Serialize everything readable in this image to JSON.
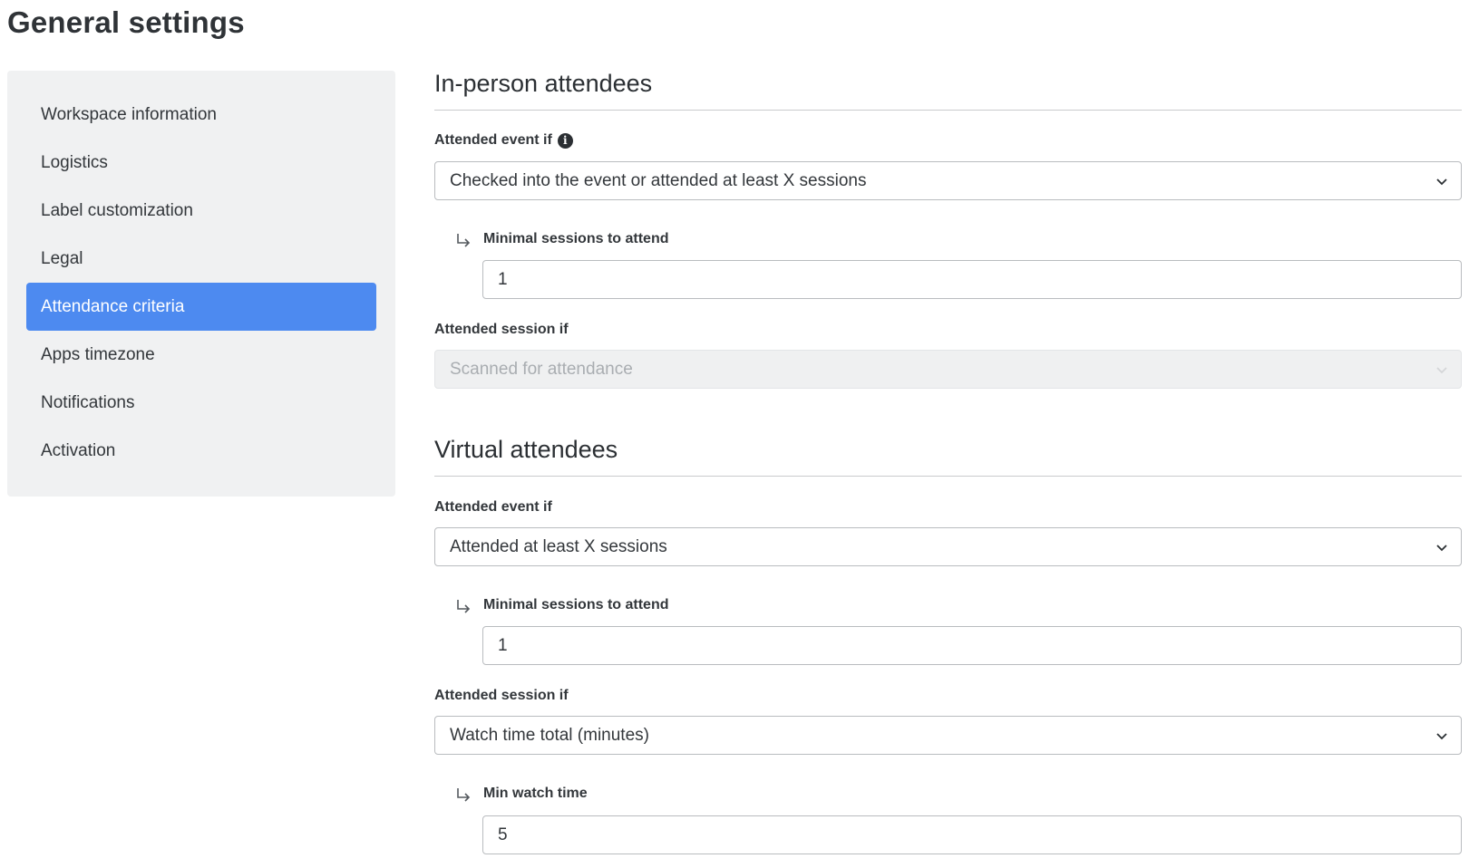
{
  "page": {
    "title": "General settings"
  },
  "sidebar": {
    "items": [
      {
        "label": "Workspace information"
      },
      {
        "label": "Logistics"
      },
      {
        "label": "Label customization"
      },
      {
        "label": "Legal"
      },
      {
        "label": "Attendance criteria",
        "active": true
      },
      {
        "label": "Apps timezone"
      },
      {
        "label": "Notifications"
      },
      {
        "label": "Activation"
      }
    ]
  },
  "in_person": {
    "title": "In-person attendees",
    "event_label": "Attended event if",
    "event_value": "Checked into the event or attended at least X sessions",
    "min_sessions_label": "Minimal sessions to attend",
    "min_sessions_value": "1",
    "session_label": "Attended session if",
    "session_value": "Scanned for attendance"
  },
  "virtual": {
    "title": "Virtual attendees",
    "event_label": "Attended event if",
    "event_value": "Attended at least X sessions",
    "min_sessions_label": "Minimal sessions to attend",
    "min_sessions_value": "1",
    "session_label": "Attended session if",
    "session_value": "Watch time total (minutes)",
    "min_watch_label": "Min watch time",
    "min_watch_value": "5"
  },
  "icons": {
    "info": "info-icon",
    "chevron": "chevron-down-icon",
    "sub_arrow": "arrow-turn-down-right-icon"
  },
  "colors": {
    "active": "#4d8af0",
    "sidebar_bg": "#f0f1f2"
  }
}
